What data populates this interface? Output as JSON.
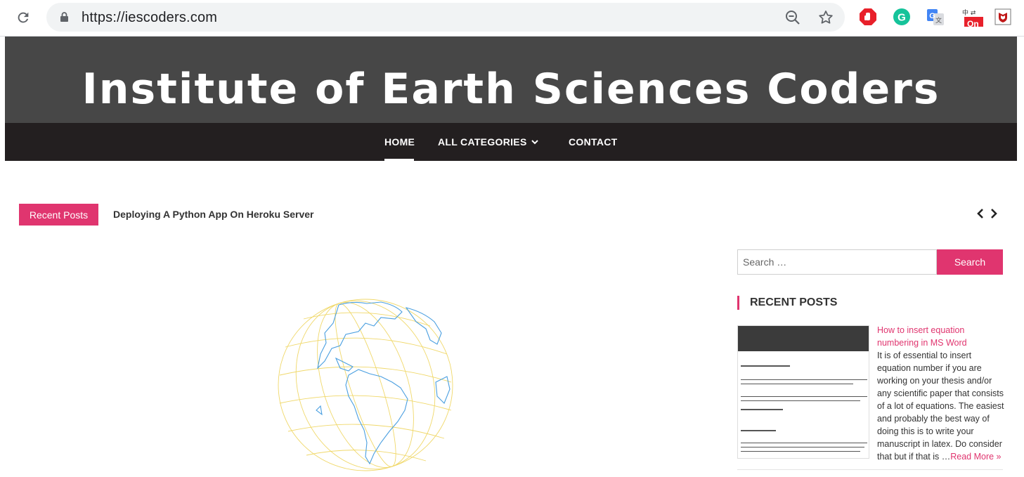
{
  "browser": {
    "url": "https://iescoders.com",
    "extensions": [
      {
        "name": "adblock-icon",
        "color": "#e8202a"
      },
      {
        "name": "grammarly-icon",
        "color": "#15c39a"
      },
      {
        "name": "translate-icon",
        "color": "#4285f4"
      },
      {
        "name": "chinese-converter-icon",
        "badge": "On"
      },
      {
        "name": "mcafee-icon",
        "color": "#c01818"
      }
    ]
  },
  "site": {
    "title": "Institute of Earth Sciences Coders",
    "nav": {
      "home": "HOME",
      "categories": "ALL CATEGORIES",
      "contact": "CONTACT"
    }
  },
  "ticker": {
    "badge": "Recent Posts",
    "headline": "Deploying A Python App On Heroku Server"
  },
  "sidebar": {
    "search": {
      "placeholder": "Search …",
      "button": "Search"
    },
    "recent_title": "RECENT POSTS",
    "post": {
      "title": "How to insert equation numbering in MS Word",
      "excerpt": "It is of essential to insert equation number if you are working on your thesis and/or any scientific paper that consists of a lot of equations. The easiest and probably the best way of doing this is to write your manuscript in latex. Do consider that but if that is …",
      "read_more": "Read More »"
    }
  },
  "colors": {
    "accent": "#e0356f",
    "banner": "#474747",
    "navbar": "#231f20"
  }
}
